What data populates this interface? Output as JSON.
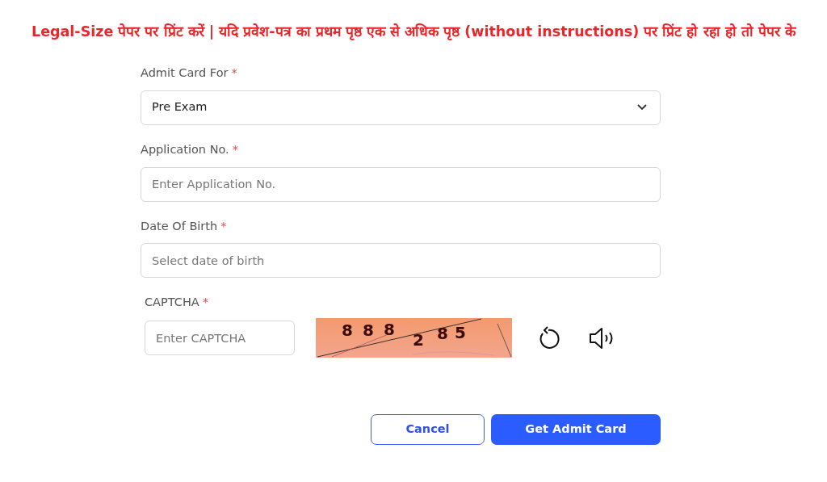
{
  "notice": "Legal-Size पेपर पर प्रिंट करें | यदि प्रवेश-पत्र का प्रथम पृष्ठ एक से अधिक पृष्ठ (without instructions) पर प्रिंट हो रहा हो तो पेपर के",
  "fields": [
    {
      "kind": "select",
      "label": "Admit Card For",
      "required_mark": "*",
      "value": "Pre Exam"
    },
    {
      "kind": "text",
      "label": "Application No.",
      "required_mark": "*",
      "placeholder": "Enter Application No."
    },
    {
      "kind": "text",
      "label": "Date Of Birth",
      "required_mark": "*",
      "placeholder": "Select date of birth"
    }
  ],
  "captcha": {
    "label": "CAPTCHA",
    "required_mark": "*",
    "placeholder": "Enter CAPTCHA",
    "characters": [
      "8",
      "8",
      "8",
      "2",
      "8",
      "5"
    ]
  },
  "buttons": [
    {
      "kind": "outline",
      "label": "Cancel"
    },
    {
      "kind": "primary",
      "label": "Get Admit Card"
    }
  ]
}
